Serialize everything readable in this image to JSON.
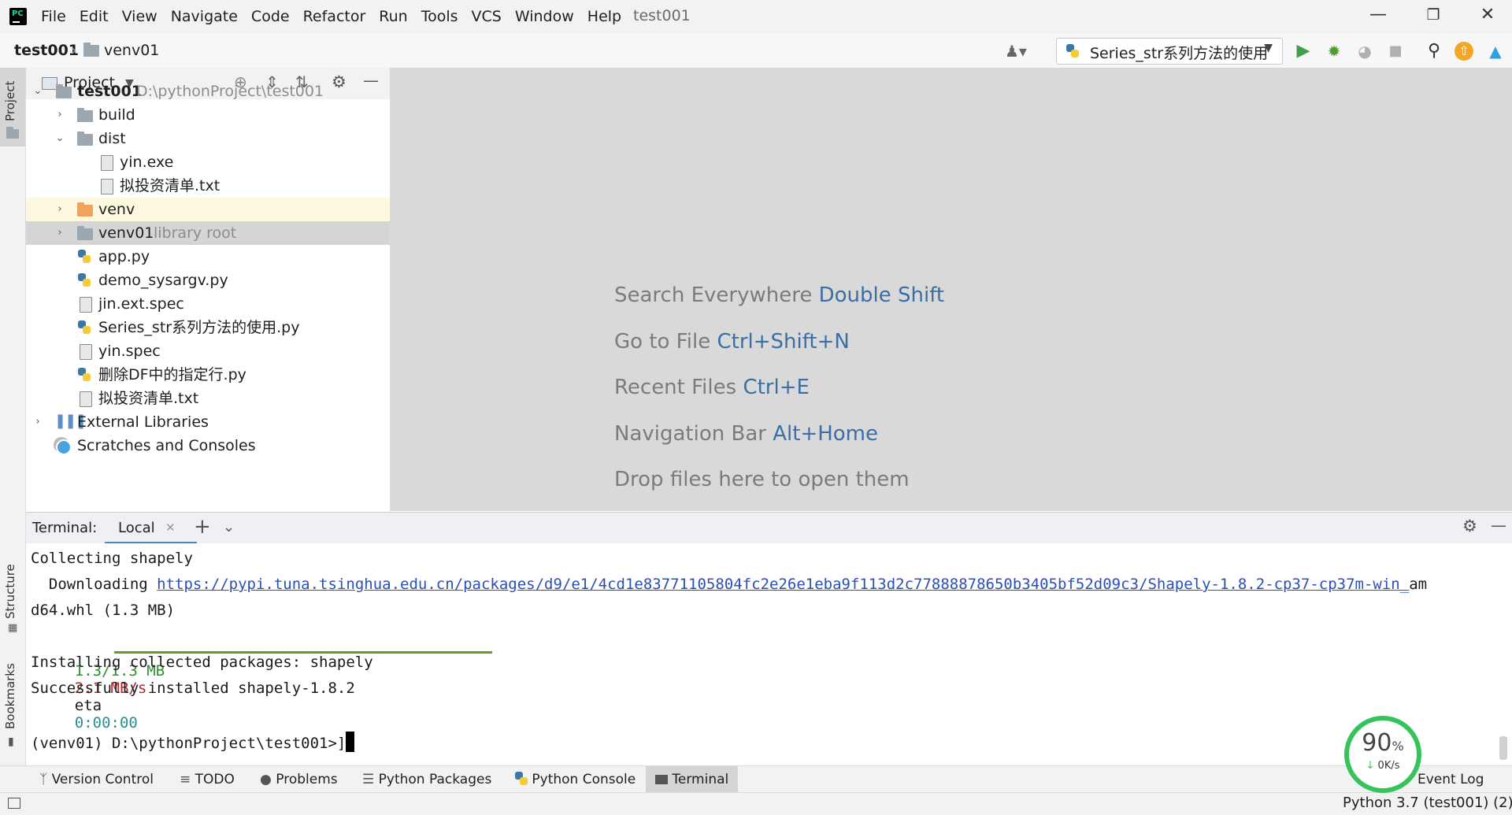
{
  "menu": {
    "items": [
      "File",
      "Edit",
      "View",
      "Navigate",
      "Code",
      "Refactor",
      "Run",
      "Tools",
      "VCS",
      "Window",
      "Help"
    ],
    "window_title": "test001"
  },
  "navbar": {
    "crumb_project": "test001",
    "crumb_folder": "venv01",
    "run_config": "Series_str系列方法的使用"
  },
  "left_stripe": {
    "project": "Project",
    "structure": "Structure",
    "bookmarks": "Bookmarks"
  },
  "project_panel": {
    "title": "Project",
    "tree": [
      {
        "label": "test001",
        "secondary": "D:\\pythonProject\\test001"
      },
      {
        "label": "build"
      },
      {
        "label": "dist"
      },
      {
        "label": "yin.exe"
      },
      {
        "label": "拟投资清单.txt"
      },
      {
        "label": "venv"
      },
      {
        "label": "venv01",
        "secondary": "library root"
      },
      {
        "label": "app.py"
      },
      {
        "label": "demo_sysargv.py"
      },
      {
        "label": "jin.ext.spec"
      },
      {
        "label": "Series_str系列方法的使用.py"
      },
      {
        "label": "yin.spec"
      },
      {
        "label": "删除DF中的指定行.py"
      },
      {
        "label": "拟投资清单.txt"
      },
      {
        "label": "External Libraries"
      },
      {
        "label": "Scratches and Consoles"
      }
    ]
  },
  "editor_hints": [
    {
      "text": "Search Everywhere",
      "key": "Double Shift"
    },
    {
      "text": "Go to File",
      "key": "Ctrl+Shift+N"
    },
    {
      "text": "Recent Files",
      "key": "Ctrl+E"
    },
    {
      "text": "Navigation Bar",
      "key": "Alt+Home"
    },
    {
      "text": "Drop files here to open them",
      "key": ""
    }
  ],
  "terminal": {
    "label": "Terminal:",
    "tab": "Local",
    "lines": {
      "collecting": "Collecting shapely",
      "downloading": "  Downloading ",
      "url": "https://pypi.tuna.tsinghua.edu.cn/packages/d9/e1/4cd1e83771105804fc2e26e1eba9f113d2c77888878650b3405bf52d09c3/Shapely-1.8.2-cp37-cp37m-win_",
      "url_tail": "am",
      "wrap": "d64.whl (1.3 MB)",
      "progress_size": "1.3/1.3 MB",
      "progress_speed": "2.1 MB/s",
      "progress_eta_label": "eta",
      "progress_eta": "0:00:00",
      "installing": "Installing collected packages: shapely",
      "success": "Successfully installed shapely-1.8.2",
      "prompt": "(venv01) D:\\pythonProject\\test001>]"
    },
    "progress": 1.0
  },
  "bottom_tabs": [
    "Version Control",
    "TODO",
    "Problems",
    "Python Packages",
    "Python Console",
    "Terminal",
    "Event Log"
  ],
  "status": {
    "interpreter": "Python 3.7 (test001) (2)"
  },
  "gauge": {
    "percent": "90",
    "percent_sign": "%",
    "speed": "0K/s"
  },
  "colors": {
    "accent": "#3a6ea5",
    "progress": "#6b9a2c",
    "gauge": "#35c35a",
    "run": "#3fa14a"
  }
}
